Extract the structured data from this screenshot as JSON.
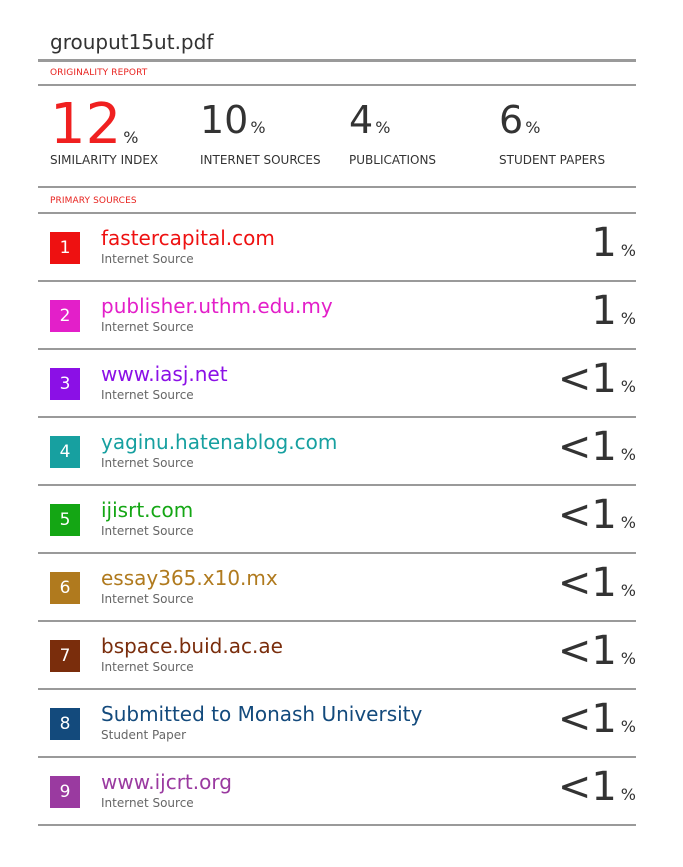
{
  "filename": "grouput15ut.pdf",
  "originality_label": "ORIGINALITY REPORT",
  "stats": [
    {
      "value": "12",
      "unit": "%",
      "label": "SIMILARITY INDEX"
    },
    {
      "value": "10",
      "unit": "%",
      "label": "INTERNET SOURCES"
    },
    {
      "value": "4",
      "unit": "%",
      "label": "PUBLICATIONS"
    },
    {
      "value": "6",
      "unit": "%",
      "label": "STUDENT PAPERS"
    }
  ],
  "primary_label": "PRIMARY SOURCES",
  "sources": [
    {
      "rank": "1",
      "title": "fastercapital.com",
      "type": "Internet Source",
      "value": "1",
      "unit": "%",
      "color": "#ee1111"
    },
    {
      "rank": "2",
      "title": "publisher.uthm.edu.my",
      "type": "Internet Source",
      "value": "1",
      "unit": "%",
      "color": "#e31fc9"
    },
    {
      "rank": "3",
      "title": "www.iasj.net",
      "type": "Internet Source",
      "value": "<1",
      "unit": "%",
      "color": "#8b10e6"
    },
    {
      "rank": "4",
      "title": "yaginu.hatenablog.com",
      "type": "Internet Source",
      "value": "<1",
      "unit": "%",
      "color": "#17a0a0"
    },
    {
      "rank": "5",
      "title": "ijisrt.com",
      "type": "Internet Source",
      "value": "<1",
      "unit": "%",
      "color": "#14a614"
    },
    {
      "rank": "6",
      "title": "essay365.x10.mx",
      "type": "Internet Source",
      "value": "<1",
      "unit": "%",
      "color": "#b07a1e"
    },
    {
      "rank": "7",
      "title": "bspace.buid.ac.ae",
      "type": "Internet Source",
      "value": "<1",
      "unit": "%",
      "color": "#7a2d0c"
    },
    {
      "rank": "8",
      "title": "Submitted to Monash University",
      "type": "Student Paper",
      "value": "<1",
      "unit": "%",
      "color": "#134a7c"
    },
    {
      "rank": "9",
      "title": "www.ijcrt.org",
      "type": "Internet Source",
      "value": "<1",
      "unit": "%",
      "color": "#9a3aa0"
    }
  ]
}
